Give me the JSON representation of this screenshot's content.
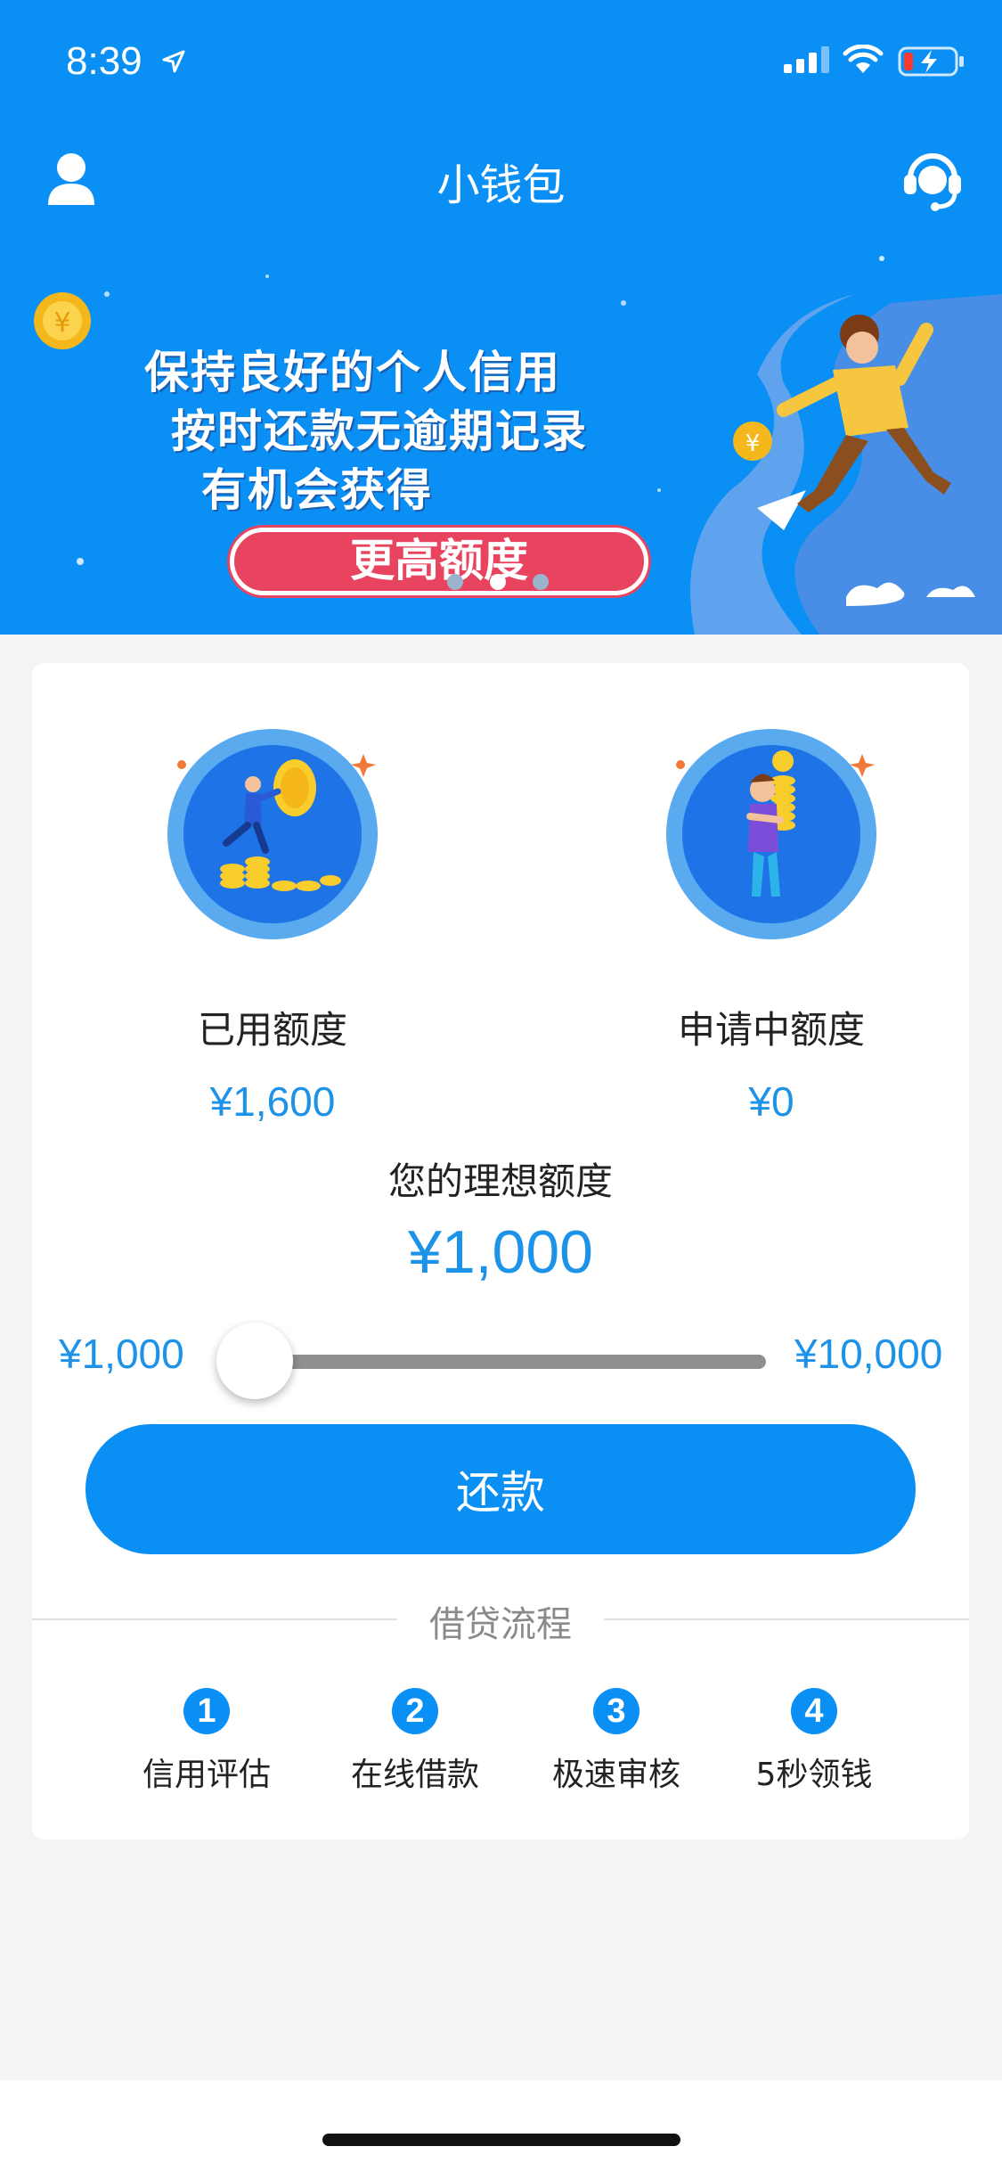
{
  "status_bar": {
    "time": "8:39"
  },
  "nav": {
    "title": "小钱包"
  },
  "banner": {
    "lines": [
      "保持良好的个人信用",
      "按时还款无逾期记录",
      "有机会获得"
    ],
    "highlight": "更高额度",
    "slide_count": 3,
    "active_slide": 1
  },
  "stats": {
    "used": {
      "label": "已用额度",
      "value": "¥1,600"
    },
    "pending": {
      "label": "申请中额度",
      "value": "¥0"
    }
  },
  "ideal": {
    "label": "您的理想额度",
    "value": "¥1,000",
    "min_label": "¥1,000",
    "max_label": "¥10,000",
    "fraction": 0
  },
  "repay_button": {
    "label": "还款"
  },
  "process": {
    "title": "借贷流程",
    "steps": [
      {
        "num": "1",
        "label": "信用评估"
      },
      {
        "num": "2",
        "label": "在线借款"
      },
      {
        "num": "3",
        "label": "极速审核"
      },
      {
        "num": "4",
        "label": "5秒领钱"
      }
    ]
  },
  "colors": {
    "primary": "#0a8ff5",
    "value_text": "#1c93e8",
    "banner_pill": "#e8445f",
    "background": "#f4f4f4"
  },
  "icons": {
    "nav_left": "user-icon",
    "nav_right": "customer-service-icon"
  }
}
